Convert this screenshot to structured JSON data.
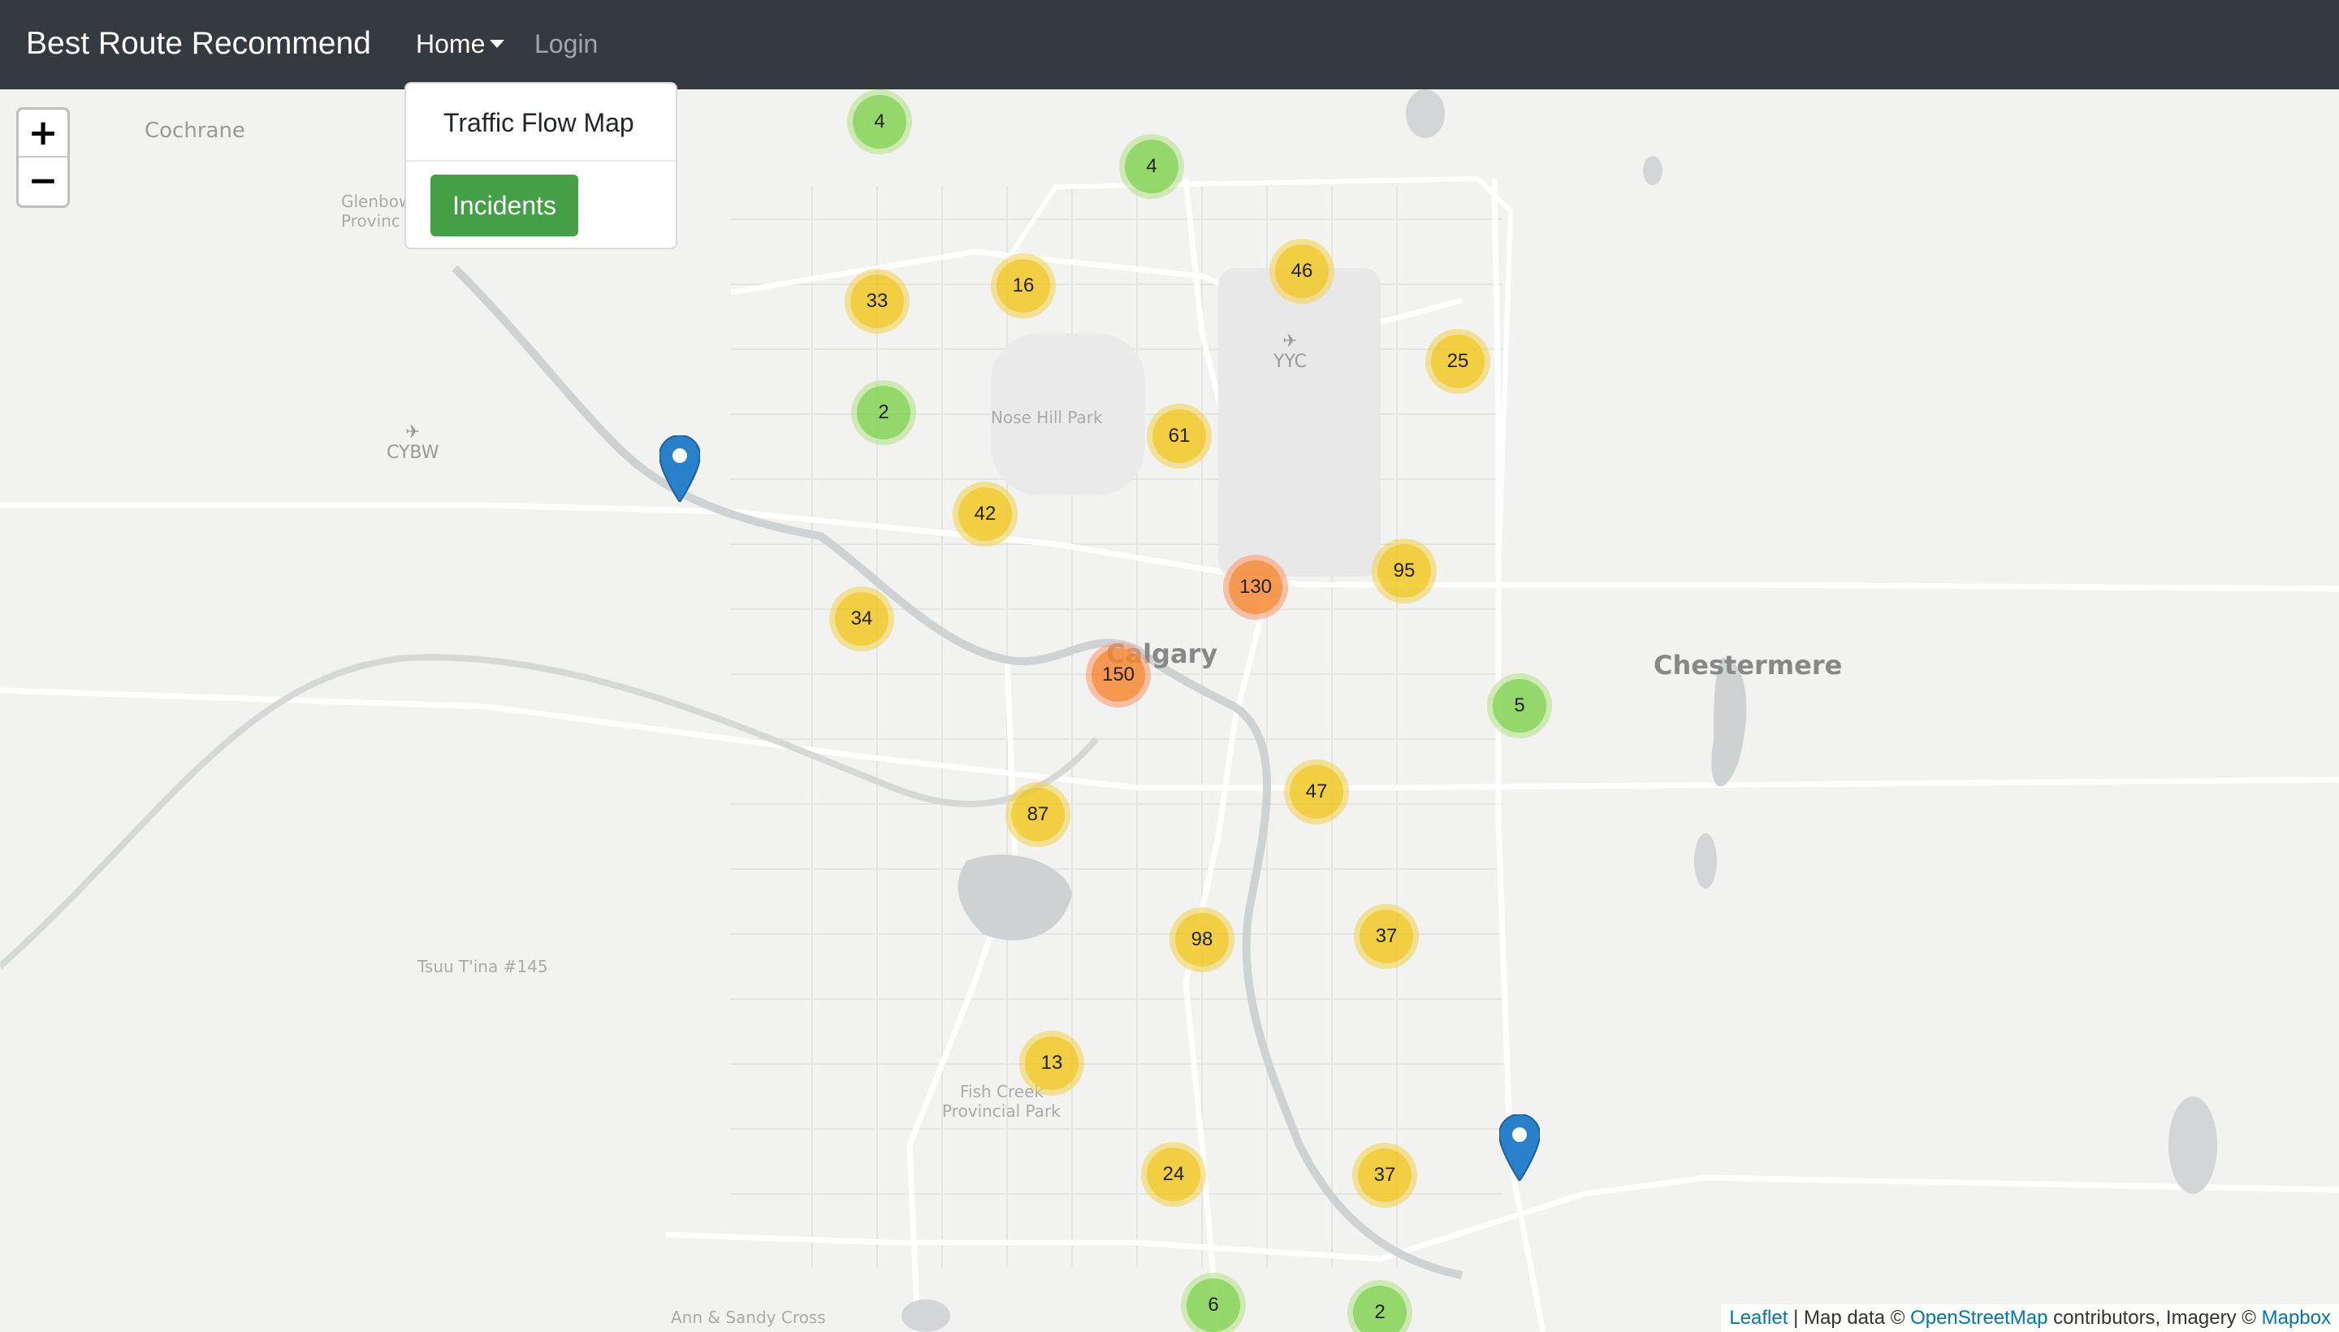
{
  "navbar": {
    "brand": "Best Route Recommend",
    "home_label": "Home",
    "login_label": "Login"
  },
  "dropdown": {
    "traffic_flow_label": "Traffic Flow Map",
    "incidents_label": "Incidents",
    "incidents_color": "#43a047"
  },
  "zoom": {
    "in_label": "+",
    "out_label": "−"
  },
  "map_labels": {
    "cochrane": "Cochrane",
    "glenbow": "Glenbow",
    "provinc": "Provinc",
    "cybw": "CYBW",
    "yyc": "YYC",
    "nose_hill": "Nose Hill Park",
    "calgary": "Calgary",
    "chestermere": "Chestermere",
    "tsuu_tina": "Tsuu T'ina #145",
    "fish_creek_1": "Fish Creek",
    "fish_creek_2": "Provincial Park",
    "ann_sandy": "Ann & Sandy Cross"
  },
  "clusters": [
    {
      "count": "4",
      "level": "small"
    },
    {
      "count": "4",
      "level": "small"
    },
    {
      "count": "33",
      "level": "medium"
    },
    {
      "count": "16",
      "level": "medium"
    },
    {
      "count": "46",
      "level": "medium"
    },
    {
      "count": "25",
      "level": "medium"
    },
    {
      "count": "2",
      "level": "small"
    },
    {
      "count": "61",
      "level": "medium"
    },
    {
      "count": "42",
      "level": "medium"
    },
    {
      "count": "130",
      "level": "large"
    },
    {
      "count": "95",
      "level": "medium"
    },
    {
      "count": "34",
      "level": "medium"
    },
    {
      "count": "150",
      "level": "large"
    },
    {
      "count": "5",
      "level": "small"
    },
    {
      "count": "47",
      "level": "medium"
    },
    {
      "count": "87",
      "level": "medium"
    },
    {
      "count": "98",
      "level": "medium"
    },
    {
      "count": "37",
      "level": "medium"
    },
    {
      "count": "13",
      "level": "medium"
    },
    {
      "count": "24",
      "level": "medium"
    },
    {
      "count": "37",
      "level": "medium"
    },
    {
      "count": "6",
      "level": "small"
    },
    {
      "count": "2",
      "level": "small"
    }
  ],
  "attribution": {
    "leaflet": "Leaflet",
    "sep1": " | Map data © ",
    "osm": "OpenStreetMap",
    "sep2": " contributors, Imagery © ",
    "mapbox": "Mapbox"
  },
  "colors": {
    "navbar_bg": "#343a40",
    "cluster_small": "#6ecc39",
    "cluster_medium": "#f0c20c",
    "cluster_large": "#f18017",
    "marker": "#2a81cb"
  }
}
